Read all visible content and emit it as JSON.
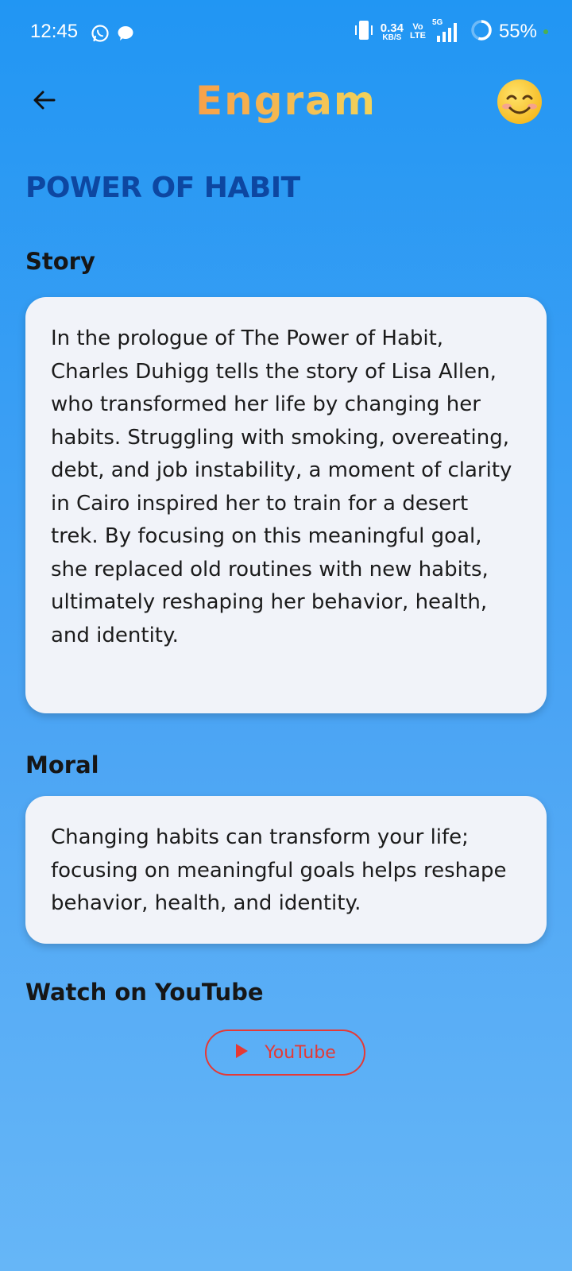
{
  "status_bar": {
    "time": "12:45",
    "net_speed_value": "0.34",
    "net_speed_unit": "KB/S",
    "volte_top": "Vo",
    "volte_bottom": "LTE",
    "network": "5G",
    "battery": "55%",
    "icons": [
      "whatsapp-icon",
      "chat-icon",
      "vibrate-icon",
      "signal-icon",
      "battery-ring-icon"
    ]
  },
  "app_bar": {
    "title": "Engram",
    "back_icon": "arrow-left-icon",
    "profile_icon": "smiling-face-emoji-icon"
  },
  "page": {
    "title": "POWER OF HABIT",
    "story_heading": "Story",
    "story_text": "In the prologue of The Power of Habit, Charles Duhigg tells the story of Lisa Allen, who transformed her life by changing her habits. Struggling with smoking, overeating, debt, and job instability, a moment of clarity in Cairo inspired her to train for a desert trek. By focusing on this meaningful goal, she replaced old routines with new habits, ultimately reshaping her behavior, health, and identity.",
    "moral_heading": "Moral",
    "moral_text": "Changing habits can transform your life; focusing on meaningful goals helps reshape behavior, health, and identity.",
    "youtube_heading": "Watch on YouTube",
    "youtube_button_label": "YouTube",
    "youtube_icon": "play-icon"
  },
  "colors": {
    "background_top": "#2196F3",
    "background_bottom": "#66b6f7",
    "title_blue": "#0d47a1",
    "card_bg": "#f1f3f9",
    "youtube_red": "#e53935"
  }
}
